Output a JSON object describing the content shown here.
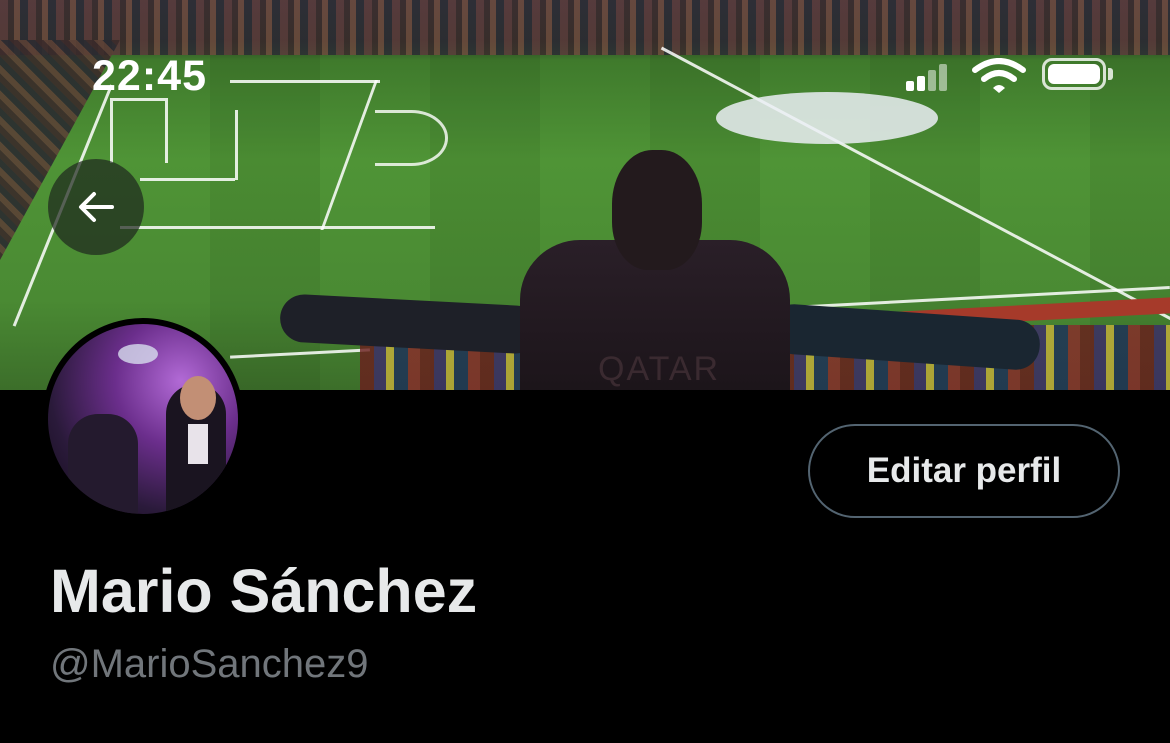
{
  "status_bar": {
    "time": "22:45",
    "signal_icon": "cellular-signal-icon",
    "wifi_icon": "wifi-icon",
    "battery_icon": "battery-icon",
    "battery_level": 1.0
  },
  "header": {
    "back_icon": "arrow-left-icon",
    "banner_image": "stadium-banner-photo",
    "jersey_text": "QATAR"
  },
  "profile": {
    "avatar_image": "profile-avatar-photo",
    "edit_button_label": "Editar perfil",
    "display_name": "Mario Sánchez",
    "handle": "@MarioSanchez9"
  },
  "colors": {
    "background": "#000000",
    "text_primary": "#e7e9ea",
    "text_secondary": "#71767b",
    "button_border": "#536471"
  }
}
